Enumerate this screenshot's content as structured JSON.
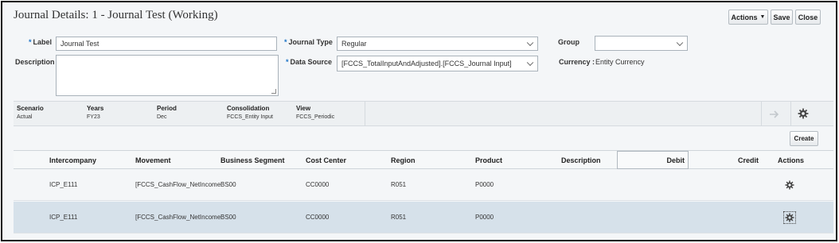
{
  "header": {
    "title": "Journal Details: 1 - Journal Test (Working)",
    "actions_label": "Actions",
    "save_label": "Save",
    "close_label": "Close"
  },
  "form": {
    "label_label": "Label",
    "label_value": "Journal Test",
    "description_label": "Description",
    "description_value": "",
    "journal_type_label": "Journal Type",
    "journal_type_value": "Regular",
    "data_source_label": "Data Source",
    "data_source_value": "[FCCS_TotalInputAndAdjusted].[FCCS_Journal Input]",
    "group_label": "Group",
    "group_value": "",
    "currency_label": "Currency :",
    "currency_value": "Entity Currency"
  },
  "pov": [
    {
      "header": "Scenario",
      "value": "Actual"
    },
    {
      "header": "Years",
      "value": "FY23"
    },
    {
      "header": "Period",
      "value": "Dec"
    },
    {
      "header": "Consolidation",
      "value": "FCCS_Entity Input"
    },
    {
      "header": "View",
      "value": "FCCS_Periodic"
    }
  ],
  "create_label": "Create",
  "grid": {
    "columns": [
      "Intercompany",
      "Movement",
      "Business Segment",
      "Cost Center",
      "Region",
      "Product",
      "Description",
      "Debit",
      "Credit",
      "Actions"
    ],
    "rows": [
      [
        "ICP_E111",
        "[FCCS_CashFlow_NetIncome",
        "BS00",
        "CC0000",
        "R051",
        "P0000",
        "",
        "",
        ""
      ],
      [
        "ICP_E111",
        "[FCCS_CashFlow_NetIncome",
        "BS00",
        "CC0000",
        "R051",
        "P0000",
        "",
        "",
        ""
      ]
    ]
  },
  "icons": {
    "pov_go": "arrow-right-icon",
    "pov_settings": "gear-icon",
    "row_actions": "gear-icon"
  }
}
